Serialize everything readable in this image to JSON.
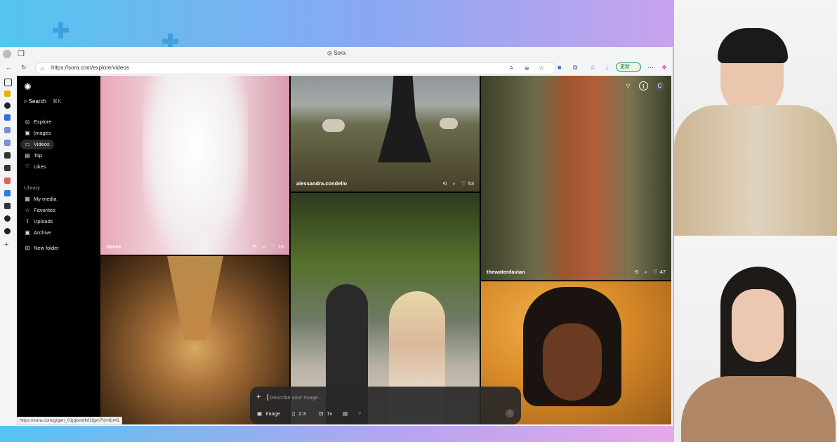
{
  "browser": {
    "tab_title": "Sora",
    "url": "https://sora.com/explore/videos",
    "update_label": "更新",
    "status_url": "https://sora.com/g/gen_01jqtxndfxf1fgm7f(m6)r41"
  },
  "sidebar": {
    "search_label": "Search",
    "search_shortcut": "⌘K",
    "nav": [
      {
        "label": "Explore",
        "icon": "compass-icon"
      },
      {
        "label": "Images",
        "icon": "image-icon"
      },
      {
        "label": "Videos",
        "icon": "video-icon"
      },
      {
        "label": "Top",
        "icon": "top-icon"
      },
      {
        "label": "Likes",
        "icon": "heart-icon"
      }
    ],
    "library_label": "Library",
    "library": [
      {
        "label": "My media",
        "icon": "media-icon"
      },
      {
        "label": "Favorites",
        "icon": "star-icon"
      },
      {
        "label": "Uploads",
        "icon": "upload-icon"
      },
      {
        "label": "Archive",
        "icon": "archive-icon"
      }
    ],
    "new_folder_label": "New folder"
  },
  "feed": {
    "tiles": [
      {
        "user": "rieeee",
        "likes": "16"
      },
      {
        "user": "alessandra.condello",
        "likes": "53"
      },
      {
        "user": "thewaterdavian",
        "likes": "47"
      }
    ]
  },
  "header": {
    "badge_count": "1",
    "avatar_letter": "C"
  },
  "composer": {
    "placeholder": "Describe your image...",
    "type_label": "Image",
    "ratio_label": "2:3",
    "count_label": "1v",
    "help_label": "?"
  },
  "colors": {
    "accent_green": "#2f9a52",
    "app_bg": "#000000"
  }
}
